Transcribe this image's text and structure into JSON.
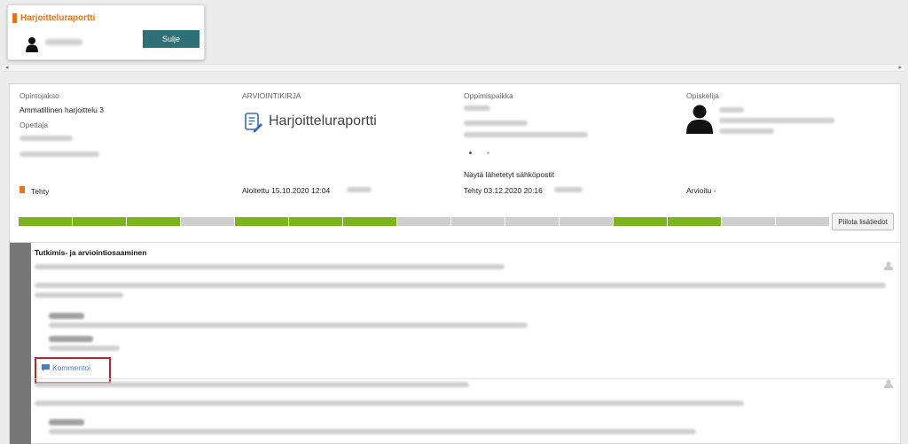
{
  "popup": {
    "title": "Harjoitteluraportti",
    "close_label": "Sulje"
  },
  "info": {
    "course_label": "Opintojakso",
    "course_value": "Ammatillinen harjoittelu 3",
    "teacher_label": "Opettaja",
    "doc_label": "ARVIOINTIKIRJA",
    "doc_title": "Harjoitteluraportti",
    "workplace_label": "Oppimispaikka",
    "email_link": "Näytä lähetetyt sähköpostit",
    "student_label": "Opiskelija",
    "status": "Tehty",
    "started": "Aloitettu 15.10.2020 12:04",
    "done": "Tehty 03.12.2020 20:16",
    "evaluated": "Arvioitu -"
  },
  "progress": {
    "segments": [
      "done",
      "done",
      "done",
      "todo",
      "done",
      "done",
      "done",
      "todo",
      "todo",
      "todo",
      "todo",
      "done",
      "done",
      "todo",
      "todo"
    ],
    "done_color": "#7ab51d",
    "todo_color": "#cfcfcf",
    "hide_label": "Piilota lisätiedot"
  },
  "section": {
    "title": "Tutkimis- ja arviointiosaaminen",
    "comment_label": "Kommentoi"
  }
}
